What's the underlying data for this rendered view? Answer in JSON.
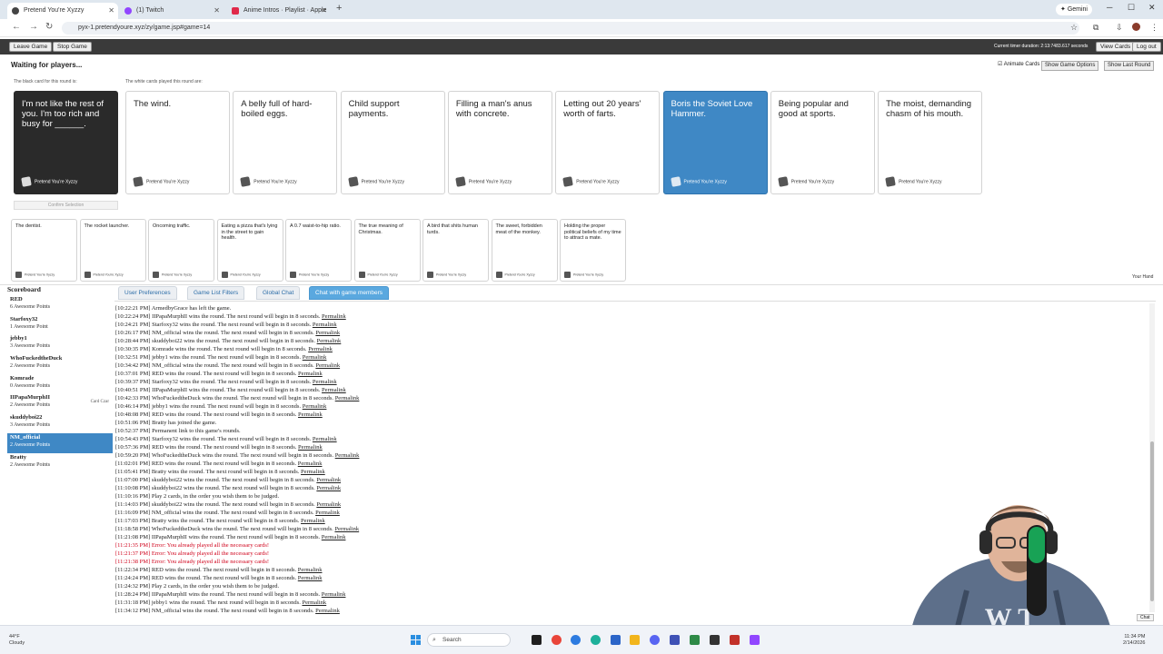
{
  "browser": {
    "tabs": [
      {
        "title": "Pretend You're Xyzzy",
        "active": true
      },
      {
        "title": "(1) Twitch",
        "active": false
      },
      {
        "title": "Anime Intros · Playlist · Apple",
        "active": false
      }
    ],
    "url": "pyx-1.pretendyoure.xyz/zy/game.jsp#game=14",
    "gemini_label": "Gemini"
  },
  "game_bar": {
    "leave_label": "Leave Game",
    "stop_label": "Stop Game",
    "timer": "Current timer duration: 2:13:7483.617 seconds",
    "view_cards_label": "View Cards",
    "logout_label": "Log out"
  },
  "status": {
    "waiting": "Waiting for players...",
    "black_card_label": "The black card for this round is:",
    "white_cards_label": "The white cards played this round are:",
    "animate_label": "Animate Cards",
    "show_options_label": "Show Game Options",
    "show_last_round_label": "Show Last Round",
    "confirm_label": "Confirm Selection",
    "your_hand_label": "Your Hand"
  },
  "black_card": {
    "text": "I'm not like the rest of you. I'm too rich and busy for ______."
  },
  "card_footer": "Pretend You're Xyzzy",
  "played_cards": [
    {
      "text": "The wind.",
      "selected": false
    },
    {
      "text": "A belly full of hard-boiled eggs.",
      "selected": false
    },
    {
      "text": "Child support payments.",
      "selected": false
    },
    {
      "text": "Filling a man's anus with concrete.",
      "selected": false
    },
    {
      "text": "Letting out 20 years' worth of farts.",
      "selected": false
    },
    {
      "text": "Boris the Soviet Love Hammer.",
      "selected": true
    },
    {
      "text": "Being popular and good at sports.",
      "selected": false
    },
    {
      "text": "The moist, demanding chasm of his mouth.",
      "selected": false
    }
  ],
  "hand_cards": [
    "The dentist.",
    "The rocket launcher.",
    "Oncoming traffic.",
    "Eating a pizza that's lying in the street to gain health.",
    "A 0.7 waist-to-hip ratio.",
    "The true meaning of Christmas.",
    "A bird that shits human turds.",
    "The sweet, forbidden meat of the monkey.",
    "Holding the proper political beliefs of my time to attract a mate."
  ],
  "scoreboard": {
    "title": "Scoreboard",
    "players": [
      {
        "name": "RED",
        "points": "6 Awesome Points",
        "status": "",
        "highlight": false
      },
      {
        "name": "Starfoxy32",
        "points": "1 Awesome Point",
        "status": "",
        "highlight": false
      },
      {
        "name": "jebby1",
        "points": "3 Awesome Points",
        "status": "",
        "highlight": false
      },
      {
        "name": "WhoFuckedtheDuck",
        "points": "2 Awesome Points",
        "status": "",
        "highlight": false
      },
      {
        "name": "Komrade",
        "points": "0 Awesome Points",
        "status": "",
        "highlight": false
      },
      {
        "name": "IIPapaMurphII",
        "points": "2 Awesome Points",
        "status": "Card Czar",
        "highlight": false
      },
      {
        "name": "skuddyboi22",
        "points": "3 Awesome Points",
        "status": "",
        "highlight": false
      },
      {
        "name": "NM_official",
        "points": "2 Awesome Points",
        "status": "",
        "highlight": true
      },
      {
        "name": "Bratty",
        "points": "2 Awesome Points",
        "status": "",
        "highlight": false
      }
    ]
  },
  "chat_tabs": [
    {
      "label": "User Preferences",
      "active": false
    },
    {
      "label": "Game List Filters",
      "active": false
    },
    {
      "label": "Global Chat",
      "active": false
    },
    {
      "label": "Chat with game members",
      "active": true
    }
  ],
  "chat_log": [
    {
      "text": "[10:22:21 PM] ArmedbyGrace has left the game.",
      "permalink": "",
      "error": false
    },
    {
      "text": "[10:22:24 PM] IIPapaMurphII wins the round. The next round will begin in 8 seconds.",
      "permalink": "Permalink",
      "error": false
    },
    {
      "text": "[10:24:21 PM] Starfoxy32 wins the round. The next round will begin in 8 seconds.",
      "permalink": "Permalink",
      "error": false
    },
    {
      "text": "[10:26:17 PM] NM_official wins the round. The next round will begin in 8 seconds.",
      "permalink": "Permalink",
      "error": false
    },
    {
      "text": "[10:28:44 PM] skuddyboi22 wins the round. The next round will begin in 8 seconds.",
      "permalink": "Permalink",
      "error": false
    },
    {
      "text": "[10:30:35 PM] Komrade wins the round. The next round will begin in 8 seconds.",
      "permalink": "Permalink",
      "error": false
    },
    {
      "text": "[10:32:51 PM] jebby1 wins the round. The next round will begin in 8 seconds.",
      "permalink": "Permalink",
      "error": false
    },
    {
      "text": "[10:34:42 PM] NM_official wins the round. The next round will begin in 8 seconds.",
      "permalink": "Permalink",
      "error": false
    },
    {
      "text": "[10:37:01 PM] RED wins the round. The next round will begin in 8 seconds.",
      "permalink": "Permalink",
      "error": false
    },
    {
      "text": "[10:39:37 PM] Starfoxy32 wins the round. The next round will begin in 8 seconds.",
      "permalink": "Permalink",
      "error": false
    },
    {
      "text": "[10:40:51 PM] IIPapaMurphII wins the round. The next round will begin in 8 seconds.",
      "permalink": "Permalink",
      "error": false
    },
    {
      "text": "[10:42:33 PM] WhoFuckedtheDuck wins the round. The next round will begin in 8 seconds.",
      "permalink": "Permalink",
      "error": false
    },
    {
      "text": "[10:46:14 PM] jebby1 wins the round. The next round will begin in 8 seconds.",
      "permalink": "Permalink",
      "error": false
    },
    {
      "text": "[10:48:08 PM] RED wins the round. The next round will begin in 8 seconds.",
      "permalink": "Permalink",
      "error": false
    },
    {
      "text": "[10:51:06 PM] Bratty has joined the game.",
      "permalink": "",
      "error": false
    },
    {
      "text": "[10:52:37 PM] Permanent link to this game's rounds.",
      "permalink": "",
      "error": false
    },
    {
      "text": "[10:54:43 PM] Starfoxy32 wins the round. The next round will begin in 8 seconds.",
      "permalink": "Permalink",
      "error": false
    },
    {
      "text": "[10:57:36 PM] RED wins the round. The next round will begin in 8 seconds.",
      "permalink": "Permalink",
      "error": false
    },
    {
      "text": "[10:59:20 PM] WhoFuckedtheDuck wins the round. The next round will begin in 8 seconds.",
      "permalink": "Permalink",
      "error": false
    },
    {
      "text": "[11:02:01 PM] RED wins the round. The next round will begin in 8 seconds.",
      "permalink": "Permalink",
      "error": false
    },
    {
      "text": "[11:05:41 PM] Bratty wins the round. The next round will begin in 8 seconds.",
      "permalink": "Permalink",
      "error": false
    },
    {
      "text": "[11:07:00 PM] skuddyboi22 wins the round. The next round will begin in 8 seconds.",
      "permalink": "Permalink",
      "error": false
    },
    {
      "text": "[11:10:08 PM] skuddyboi22 wins the round. The next round will begin in 8 seconds.",
      "permalink": "Permalink",
      "error": false
    },
    {
      "text": "[11:10:16 PM] Play 2 cards, in the order you wish them to be judged.",
      "permalink": "",
      "error": false
    },
    {
      "text": "[11:14:03 PM] skuddyboi22 wins the round. The next round will begin in 8 seconds.",
      "permalink": "Permalink",
      "error": false
    },
    {
      "text": "[11:16:09 PM] NM_official wins the round. The next round will begin in 8 seconds.",
      "permalink": "Permalink",
      "error": false
    },
    {
      "text": "[11:17:03 PM] Bratty wins the round. The next round will begin in 8 seconds.",
      "permalink": "Permalink",
      "error": false
    },
    {
      "text": "[11:18:58 PM] WhoFuckedtheDuck wins the round. The next round will begin in 8 seconds.",
      "permalink": "Permalink",
      "error": false
    },
    {
      "text": "[11:21:08 PM] IIPapaMurphII wins the round. The next round will begin in 8 seconds.",
      "permalink": "Permalink",
      "error": false
    },
    {
      "text": "[11:21:35 PM] Error: You already played all the necessary cards!",
      "permalink": "",
      "error": true
    },
    {
      "text": "[11:21:37 PM] Error: You already played all the necessary cards!",
      "permalink": "",
      "error": true
    },
    {
      "text": "[11:21:38 PM] Error: You already played all the necessary cards!",
      "permalink": "",
      "error": true
    },
    {
      "text": "[11:22:34 PM] RED wins the round. The next round will begin in 8 seconds.",
      "permalink": "Permalink",
      "error": false
    },
    {
      "text": "[11:24:24 PM] RED wins the round. The next round will begin in 8 seconds.",
      "permalink": "Permalink",
      "error": false
    },
    {
      "text": "[11:24:32 PM] Play 2 cards, in the order you wish them to be judged.",
      "permalink": "",
      "error": false
    },
    {
      "text": "[11:28:24 PM] IIPapaMurphII wins the round. The next round will begin in 8 seconds.",
      "permalink": "Permalink",
      "error": false
    },
    {
      "text": "[11:31:18 PM] jebby1 wins the round. The next round will begin in 8 seconds.",
      "permalink": "Permalink",
      "error": false
    },
    {
      "text": "[11:34:12 PM] NM_official wins the round. The next round will begin in 8 seconds.",
      "permalink": "Permalink",
      "error": false
    }
  ],
  "chat_button_label": "Chat",
  "taskbar": {
    "weather_temp": "44°F",
    "weather_desc": "Cloudy",
    "search_placeholder": "Search",
    "time": "11:34 PM",
    "date": "2/14/2026"
  },
  "colors": {
    "selected_card": "#3f88c5",
    "black_card": "#2a2a2a",
    "active_chat_tab": "#5aa8df",
    "error_text": "#d0021b"
  }
}
